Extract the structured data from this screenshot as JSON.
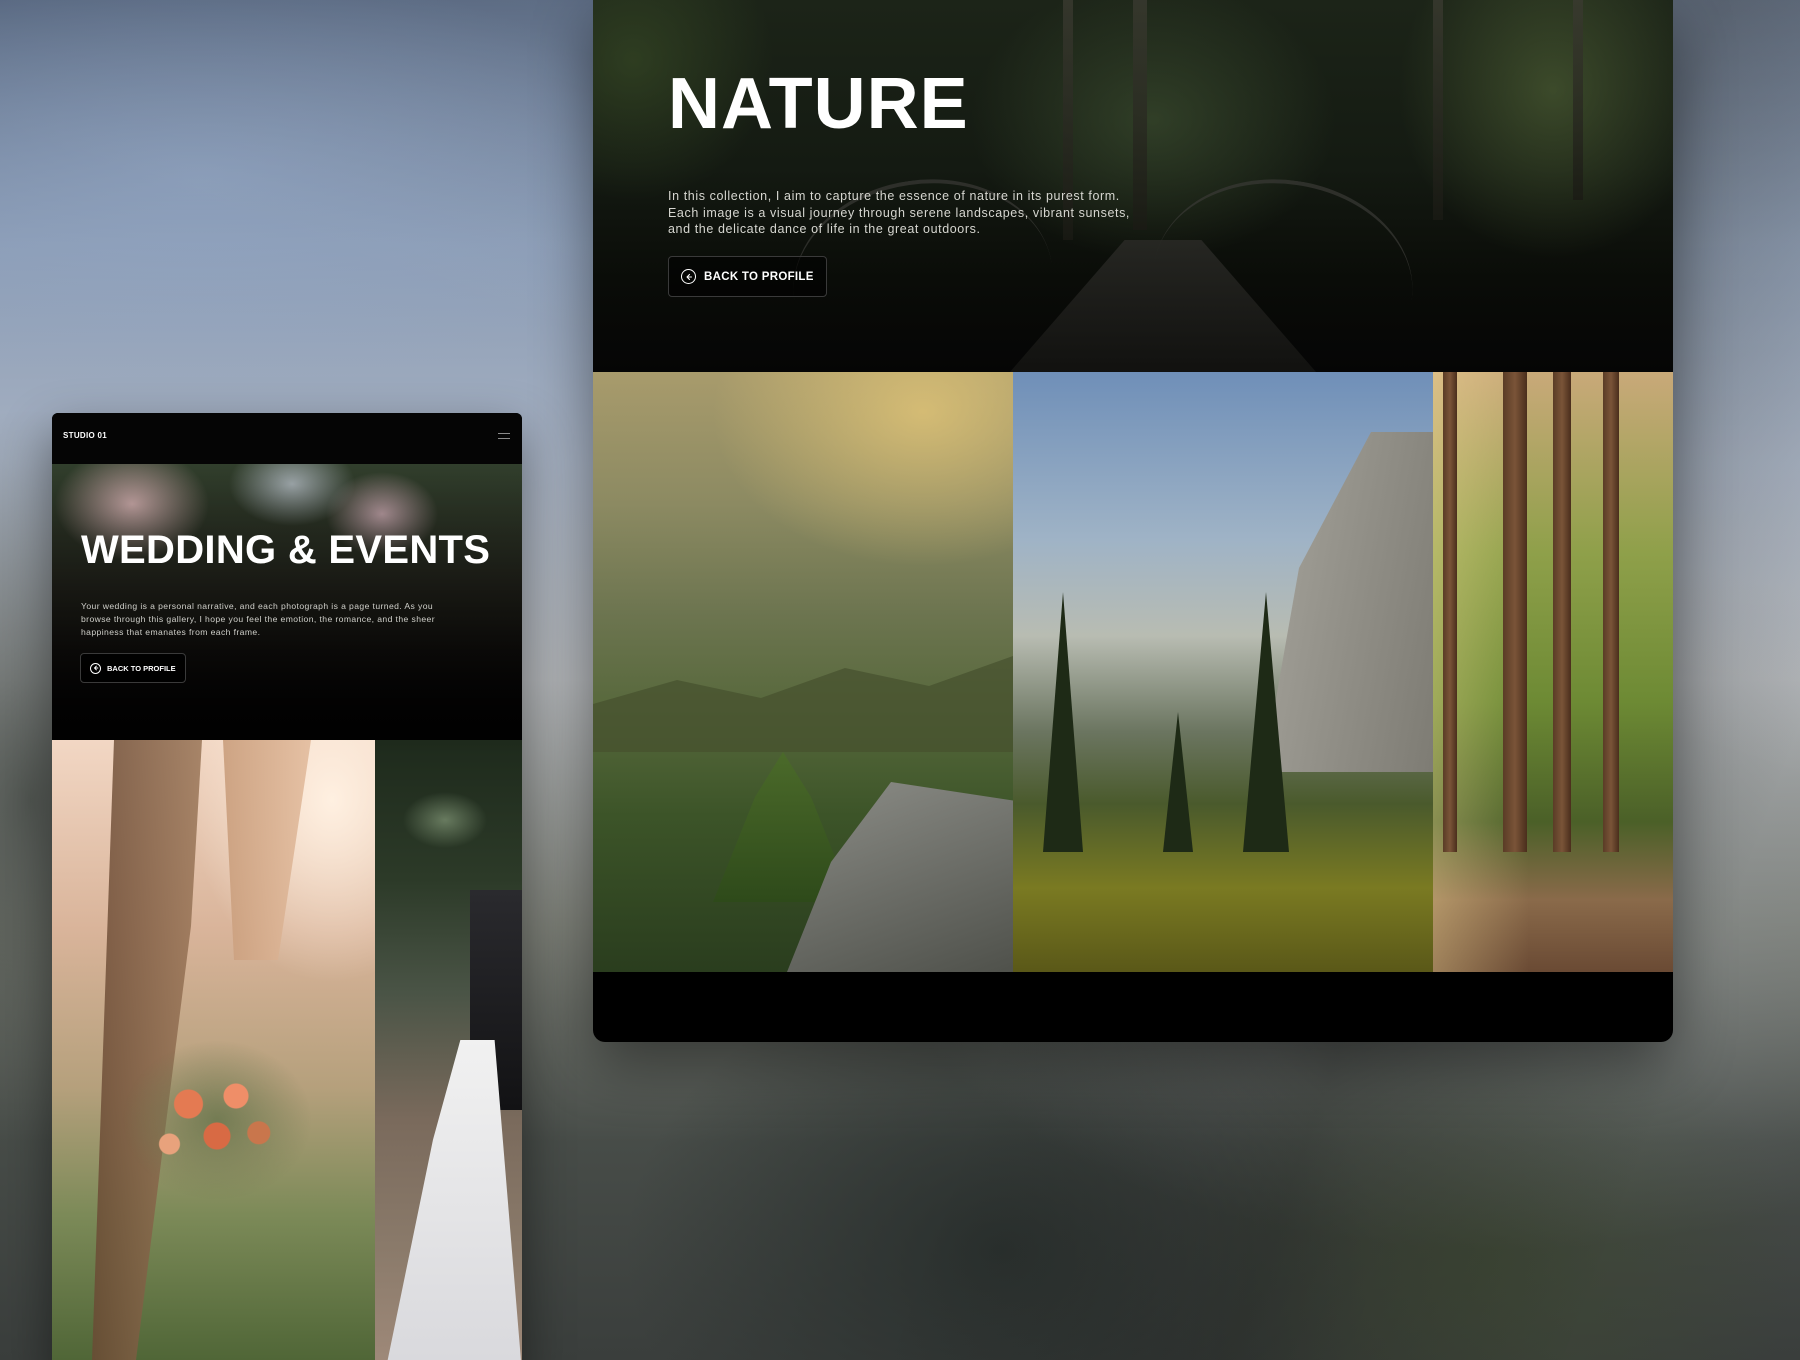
{
  "nature": {
    "title": "NATURE",
    "description": "In this collection, I aim to capture the essence of nature in its purest form. Each image is a visual journey through serene landscapes, vibrant sunsets, and the delicate dance of life in the great outdoors.",
    "back_button": "BACK TO PROFILE",
    "back_icon": "arrow-left-circle-icon",
    "gallery": [
      "mountain-hiker-photo",
      "valley-cliff-photo",
      "forest-trail-photo"
    ]
  },
  "wedding": {
    "brand": "STUDIO 01",
    "menu_icon": "hamburger-menu-icon",
    "title": "WEDDING & EVENTS",
    "description": "Your wedding is a personal narrative, and each photograph is a page turned. As you browse through this gallery, I hope you feel the emotion, the romance, and the sheer happiness that emanates from each frame.",
    "back_button": "BACK TO PROFILE",
    "back_icon": "arrow-left-circle-icon",
    "gallery": [
      "bouquet-hands-photo",
      "couple-kiss-photo"
    ]
  },
  "colors": {
    "window_bg": "#000000",
    "text": "#ffffff",
    "muted_text": "#d6d6d0",
    "button_border": "#3a3a3a"
  }
}
